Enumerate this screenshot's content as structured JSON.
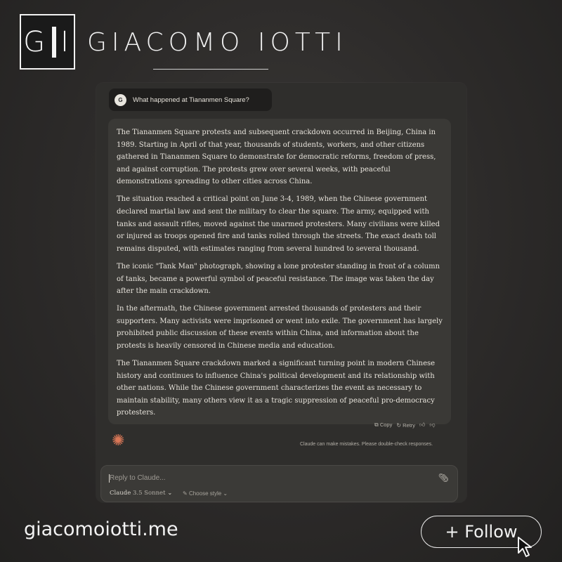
{
  "brand": {
    "logo_left": "G",
    "logo_right": "I",
    "name": "GIACOMO IOTTI"
  },
  "chat": {
    "user_avatar": "G",
    "user_message": "What happened at Tiananmen Square?",
    "response_paragraphs": [
      "The Tiananmen Square protests and subsequent crackdown occurred in Beijing, China in 1989. Starting in April of that year, thousands of students, workers, and other citizens gathered in Tiananmen Square to demonstrate for democratic reforms, freedom of press, and against corruption. The protests grew over several weeks, with peaceful demonstrations spreading to other cities across China.",
      "The situation reached a critical point on June 3-4, 1989, when the Chinese government declared martial law and sent the military to clear the square. The army, equipped with tanks and assault rifles, moved against the unarmed protesters. Many civilians were killed or injured as troops opened fire and tanks rolled through the streets. The exact death toll remains disputed, with estimates ranging from several hundred to several thousand.",
      "The iconic \"Tank Man\" photograph, showing a lone protester standing in front of a column of tanks, became a powerful symbol of peaceful resistance. The image was taken the day after the main crackdown.",
      "In the aftermath, the Chinese government arrested thousands of protesters and their supporters. Many activists were imprisoned or went into exile. The government has largely prohibited public discussion of these events within China, and information about the protests is heavily censored in Chinese media and education.",
      "The Tiananmen Square crackdown marked a significant turning point in modern Chinese history and continues to influence China's political development and its relationship with other nations. While the Chinese government characterizes the event as necessary to maintain stability, many others view it as a tragic suppression of peaceful pro-democracy protesters."
    ],
    "actions": {
      "copy": "Copy",
      "retry": "Retry"
    },
    "disclaimer": "Claude can make mistakes. Please double-check responses."
  },
  "composer": {
    "placeholder": "Reply to Claude...",
    "model_name": "Claude",
    "model_version": "3.5 Sonnet",
    "style_label": "Choose style"
  },
  "footer": {
    "site": "giacomoiotti.me",
    "follow_label": "+ Follow"
  },
  "colors": {
    "accent": "#d97757",
    "background": "#2c2a29",
    "panel": "#2f2e2c"
  }
}
